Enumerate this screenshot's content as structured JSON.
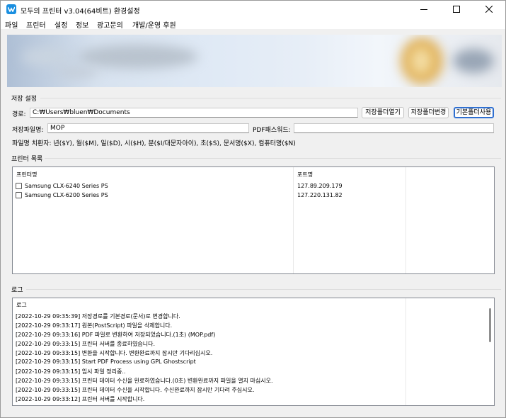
{
  "window": {
    "title": "모두의 프린터 v3.04(64비트) 환경설정"
  },
  "menu": [
    "파일",
    "프린터",
    "설정",
    "정보",
    "광고문의",
    "개발/운영 후원"
  ],
  "storage": {
    "group_title": "저장 설정",
    "path_label": "경로:",
    "path_value": "C:₩Users₩bluen₩Documents",
    "open_folder_button": "저장폴더열기",
    "change_folder_button": "저장폴더변경",
    "default_folder_button": "기본폴더사용",
    "filename_label": "저장파일명:",
    "filename_value": "MOP",
    "pdf_password_label": "PDF패스워드:",
    "pdf_password_value": "",
    "substitution_help": "파일명 치환자: 년($Y), 월($M), 일($D), 시($H), 분($I/대문자아이), 초($S), 문서명($X), 컴퓨터명($N)"
  },
  "printers": {
    "group_title": "프린터 목록",
    "columns": [
      "프린터명",
      "포트명"
    ],
    "rows": [
      {
        "name": "Samsung CLX-6240 Series PS",
        "port": "127.89.209.179"
      },
      {
        "name": "Samsung CLX-6200 Series PS",
        "port": "127.220.131.82"
      }
    ]
  },
  "log": {
    "group_title": "로그",
    "column": "로그",
    "lines": [
      "[2022-10-29 09:35:39] 저장경로를 기본경로(문서)로 변경합니다.",
      "[2022-10-29 09:33:17] 원본(PostScript) 파일을 삭제합니다.",
      "[2022-10-29 09:33:16] PDF 파일로 변환하여 저장되었습니다.(1초) (MOP.pdf)",
      "[2022-10-29 09:33:15] 프린터 서버를 종료하였습니다.",
      "[2022-10-29 09:33:15] 변환을 시작합니다. 변환완료까지 잠시만 기다리십시오.",
      "[2022-10-29 09:33:15] Start PDF Process using GPL Ghostscript",
      "[2022-10-29 09:33:15] 임시 파일 정리중..",
      "[2022-10-29 09:33:15] 프린터 데이터 수신을 완료하였습니다.(0초) 변환완료까지 파일을 열지 마십시오.",
      "[2022-10-29 09:33:15] 프린터 데이터 수신을 시작합니다. 수신완료까지 잠시만 기다려 주십시오.",
      "[2022-10-29 09:33:12] 프린터 서버를 시작합니다."
    ]
  },
  "colors": {
    "accent": "#1a8fe0",
    "default_button_border": "#2f6fd0"
  },
  "icons": [
    "app-icon",
    "minimize-icon",
    "maximize-icon",
    "close-icon",
    "checkbox-icon"
  ]
}
